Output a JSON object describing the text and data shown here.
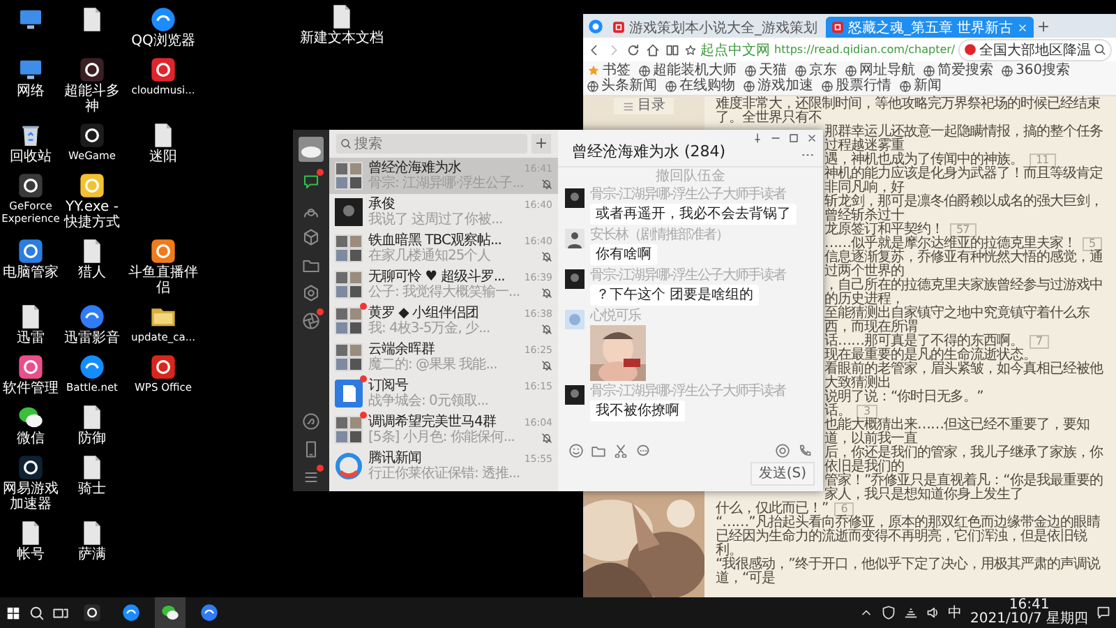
{
  "desktop": {
    "rows": [
      [
        {
          "kind": "pc"
        },
        {
          "kind": "file"
        },
        {
          "label": "QQ浏览器",
          "kind": "round",
          "color": "#1a8cff"
        }
      ],
      [
        {
          "label": "网络",
          "kind": "pc"
        },
        {
          "label": "超能斗多神",
          "kind": "tile",
          "color": "#3a1f24"
        },
        {
          "label": "cloudmusi...",
          "kind": "tile",
          "color": "#e0242c"
        }
      ],
      [
        {
          "label": "回收站",
          "kind": "bin"
        },
        {
          "label": "WeGame",
          "kind": "tile",
          "color": "#1c1c1c"
        },
        {
          "label": "迷阳",
          "kind": "file"
        }
      ],
      [
        {
          "label": "GeForce Experience",
          "kind": "tile",
          "color": "#3a3a3a"
        },
        {
          "label": "YY.exe - 快捷方式",
          "kind": "tile",
          "color": "#f2c232"
        }
      ],
      [
        {
          "label": "电脑管家",
          "kind": "tile",
          "color": "#2a7de1"
        },
        {
          "label": "猎人",
          "kind": "file"
        },
        {
          "label": "斗鱼直播伴侣",
          "kind": "tile",
          "color": "#f07b1d"
        }
      ],
      [
        {
          "label": "迅雷",
          "kind": "file"
        },
        {
          "label": "迅雷影音",
          "kind": "round",
          "color": "#2f7cf6"
        },
        {
          "label": "update_ca...",
          "kind": "folder"
        }
      ],
      [
        {
          "label": "软件管理",
          "kind": "tile",
          "color": "#e94f8a"
        },
        {
          "label": "Battle.net",
          "kind": "round",
          "color": "#148eff"
        },
        {
          "label": "WPS Office",
          "kind": "tile",
          "color": "#d9261c"
        }
      ],
      [
        {
          "label": "微信",
          "kind": "wechat"
        },
        {
          "label": "防御",
          "kind": "file"
        }
      ],
      [
        {
          "label": "网易游戏加速器",
          "kind": "tile",
          "color": "#0f2233"
        },
        {
          "label": "骑士",
          "kind": "file"
        }
      ],
      [
        {
          "label": "帐号",
          "kind": "file"
        },
        {
          "label": "萨满",
          "kind": "file"
        }
      ]
    ],
    "loose_file": {
      "label": "新建文本文档",
      "kind": "file"
    }
  },
  "browser": {
    "tabs": [
      {
        "label": "游戏策划本小说大全_游戏策划",
        "selected": false
      },
      {
        "label": "怒藏之魂_第五章 世界新古",
        "selected": true
      }
    ],
    "address": {
      "site": "起点中文网",
      "url": "https://read.qidian.com/chapter/"
    },
    "search": {
      "value": "全国大部地区降温"
    },
    "bookmarks": [
      {
        "label": "书签",
        "kind": "folder"
      },
      {
        "label": "超能装机大师",
        "kind": "site"
      },
      {
        "label": "天猫",
        "kind": "site"
      },
      {
        "label": "京东",
        "kind": "site"
      },
      {
        "label": "网址导航",
        "kind": "site"
      },
      {
        "label": "简爱搜索",
        "kind": "site"
      },
      {
        "label": "360搜索",
        "kind": "site"
      },
      {
        "label": "头条新闻",
        "kind": "site"
      },
      {
        "label": "在线购物",
        "kind": "site"
      },
      {
        "label": "游戏加速",
        "kind": "site"
      },
      {
        "label": "股票行情",
        "kind": "site"
      },
      {
        "label": "新闻",
        "kind": "site"
      }
    ],
    "toc_button": "目录",
    "paragraphs": [
      {
        "text": "难度非常大，还限制时间，等他攻略完万界祭祀场的时候已经结束了。全世界只有不"
      },
      {
        "text": "那群幸运儿还故意一起隐瞒情报，搞的整个任务过程越迷雾重"
      },
      {
        "text": "遇，神机也成为了传闻中的神族。",
        "comments": "11"
      },
      {
        "text": "神机的能力应该是化身为武器了！而且等级肯定非同凡响，好"
      },
      {
        "text": "斩龙剑，那可是凛冬伯爵赖以成名的强大巨剑，曾经斩杀过十"
      },
      {
        "text": "龙原签订和平契约！",
        "comments": "57"
      },
      {
        "text": "……似乎就是摩尔达维亚的拉德克里夫家！",
        "comments": "5"
      },
      {
        "text": "信息逐渐复苏，乔修亚有种恍然大悟的感觉，通过两个世界的"
      },
      {
        "text": "，自己所在的拉德克里夫家族曾经参与过游戏中的历史进程，"
      },
      {
        "text": "至能猜测出自家镇守之地中究竟镇守着什么东西，而现在所谓"
      },
      {
        "text": "话……那可真是了不得的东西啊。",
        "comments": "7"
      },
      {
        "text": "现在最重要的是凡的生命流逝状态。"
      },
      {
        "text": "看眼前的老管家，眉头紧皱，如今真相已经被他大致猜测出"
      },
      {
        "text": "说明了说：“你时日无多。”"
      },
      {
        "text": "话。",
        "comments": "3"
      },
      {
        "text": "也能大概猜出来……但这已经不重要了，要知道，以前我一直"
      },
      {
        "text": "后，你还是我们的管家，我儿子继承了家族，你依旧是我们的"
      },
      {
        "text": "管家！”乔修亚只是直视着凡：“你是我最重要的家人，我只是想知道你身上发生了"
      },
      {
        "text": "什么，仅此而已！”",
        "comments": "6"
      },
      {
        "text": "“……”凡抬起头看向乔修亚，原本的那双红色而边缘带金边的眼睛已经因为生命力的流逝而变得不再明亮，它们浑浊，但是依旧锐利。"
      },
      {
        "text": "“我很感动，”终于开口，他似乎下定了决心，用极其严肃的声调说道，“可是"
      }
    ]
  },
  "wechat": {
    "sidebar": [
      {
        "kind": "chat",
        "selected": true,
        "dot": true
      },
      {
        "kind": "person",
        "selected": false,
        "dot": false
      },
      {
        "kind": "cube",
        "selected": false,
        "dot": false
      },
      {
        "kind": "folder",
        "selected": false,
        "dot": false
      },
      {
        "kind": "hex",
        "selected": false,
        "dot": false
      },
      {
        "kind": "aperture",
        "selected": false,
        "dot": true
      }
    ],
    "sidebar_bottom": [
      {
        "kind": "mini",
        "dot": false
      },
      {
        "kind": "phone",
        "dot": false
      },
      {
        "kind": "menu",
        "dot": true
      }
    ],
    "search": {
      "placeholder": "搜索"
    },
    "add_button": "+",
    "chats": [
      {
        "name": "曾经沧海难为水",
        "preview": "骨宗: 江湖异哪·浮生公子...",
        "time": "16:41",
        "avatar": {
          "kind": "group"
        },
        "selected": true,
        "muted": true,
        "dot": false
      },
      {
        "name": "承俊",
        "preview": "我说了 这周过了你被...",
        "time": "16:40",
        "avatar": {
          "kind": "dark"
        },
        "selected": false,
        "muted": false,
        "dot": false
      },
      {
        "name": "铁血暗黑 TBC观察帖...",
        "preview": "在家几楼通知25个人",
        "time": "16:40",
        "avatar": {
          "kind": "group"
        },
        "selected": false,
        "muted": true,
        "dot": false
      },
      {
        "name": "无聊可怜 ♥ 超级斗罗...",
        "preview": "公子: 我觉得大概笑输一...",
        "time": "16:39",
        "avatar": {
          "kind": "group"
        },
        "selected": false,
        "muted": true,
        "dot": false
      },
      {
        "name": "黄罗 ◆ 小组伴侣团",
        "preview": "我: 4枚3-5万金, 少...",
        "time": "16:38",
        "avatar": {
          "kind": "group"
        },
        "selected": false,
        "muted": true,
        "dot": true
      },
      {
        "name": "云端余晖群",
        "preview": "魔二的: @果果 我能...",
        "time": "16:25",
        "avatar": {
          "kind": "group"
        },
        "selected": false,
        "muted": true,
        "dot": false
      },
      {
        "name": "订阅号",
        "preview": "战争城会: 0元领取...",
        "time": "16:15",
        "avatar": {
          "kind": "doc"
        },
        "selected": false,
        "muted": false,
        "dot": true
      },
      {
        "name": "调调希望完美世马4群",
        "preview": "[5条] 小月色: 你能保何...",
        "time": "16:04",
        "avatar": {
          "kind": "group"
        },
        "selected": false,
        "muted": true,
        "dot": true
      },
      {
        "name": "腾讯新闻",
        "preview": "行正你莱依证保错: 透推...",
        "time": "15:55",
        "avatar": {
          "kind": "news"
        },
        "selected": false,
        "muted": false,
        "dot": false
      }
    ],
    "title": "曾经沧海难为水 (284)",
    "system_note": "撤回队伍金",
    "messages": [
      {
        "sender": "骨宗-江湖异哪-浮生公子大师手读者",
        "text": "或者再遥开，我必不会去背锅了",
        "avatar": {
          "kind": "dark"
        },
        "kind": "text"
      },
      {
        "sender": "安长林（剧情推部准者）",
        "text": "你有啥啊",
        "avatar": {
          "kind": "person"
        },
        "kind": "text"
      },
      {
        "sender": "骨宗-江湖异哪-浮生公子大师手读者",
        "text": "？下午这个 团要是啥组的",
        "avatar": {
          "kind": "dark"
        },
        "kind": "text"
      },
      {
        "sender": "心悦可乐",
        "avatar": {
          "kind": "pale"
        }
      },
      {
        "sender": "骨宗-江湖异哪-浮生公子大师手读者",
        "text": "我不被你撩啊",
        "avatar": {
          "kind": "dark"
        },
        "kind": "text"
      }
    ],
    "send_button": "发送(S)"
  },
  "taskbar": {
    "apps": [
      {
        "kind": "tile",
        "color": "#2b2b2b",
        "selected": false
      },
      {
        "kind": "round",
        "color": "#1a8cff",
        "selected": false
      },
      {
        "kind": "wechat",
        "selected": true
      },
      {
        "kind": "round",
        "color": "#2f7cf6",
        "selected": false
      }
    ],
    "ime": "中",
    "time": "16:41",
    "date": "2021/10/7 星期四"
  }
}
